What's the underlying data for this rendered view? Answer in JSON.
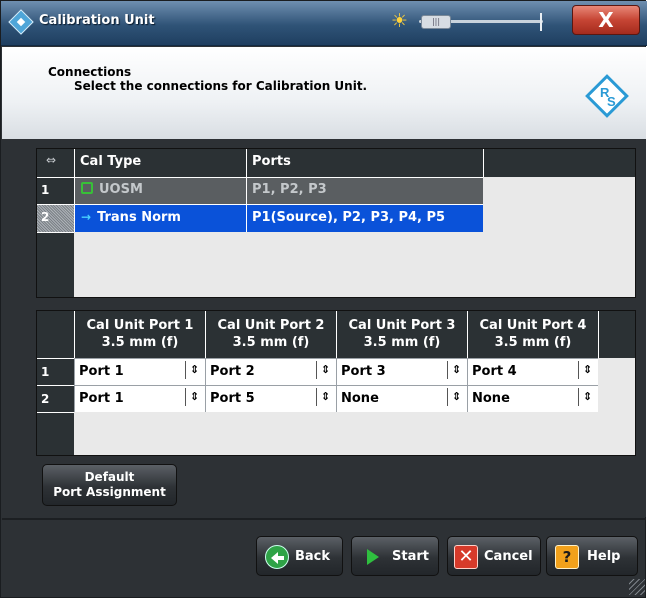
{
  "window": {
    "title": "Calibration Unit",
    "close_label": "X"
  },
  "header": {
    "title": "Connections",
    "subtitle": "Select the connections for Calibration Unit."
  },
  "cal_table": {
    "columns": [
      "Cal Type",
      "Ports"
    ],
    "rows": [
      {
        "index": "1",
        "cal_type": "UOSM",
        "ports": "P1, P2, P3",
        "icon": "uosm-icon"
      },
      {
        "index": "2",
        "cal_type": "Trans Norm",
        "ports": "P1(Source), P2, P3, P4, P5",
        "icon": "arrow-icon"
      }
    ],
    "selected_row": 2
  },
  "port_table": {
    "columns": [
      {
        "name": "Cal Unit Port 1",
        "connector": "3.5 mm (f)"
      },
      {
        "name": "Cal Unit Port 2",
        "connector": "3.5 mm (f)"
      },
      {
        "name": "Cal Unit Port 3",
        "connector": "3.5 mm (f)"
      },
      {
        "name": "Cal Unit Port 4",
        "connector": "3.5 mm (f)"
      }
    ],
    "rows": [
      {
        "index": "1",
        "values": [
          "Port 1",
          "Port 2",
          "Port 3",
          "Port 4"
        ]
      },
      {
        "index": "2",
        "values": [
          "Port 1",
          "Port 5",
          "None",
          "None"
        ]
      }
    ]
  },
  "buttons": {
    "default_line1": "Default",
    "default_line2": "Port Assignment",
    "back": "Back",
    "start": "Start",
    "cancel": "Cancel",
    "help": "Help"
  },
  "colors": {
    "selection_blue": "#0a52d9",
    "title_blue": "#2f5377",
    "cancel_red": "#d63a2a",
    "help_orange": "#f2a11b",
    "back_green": "#2fa347"
  }
}
